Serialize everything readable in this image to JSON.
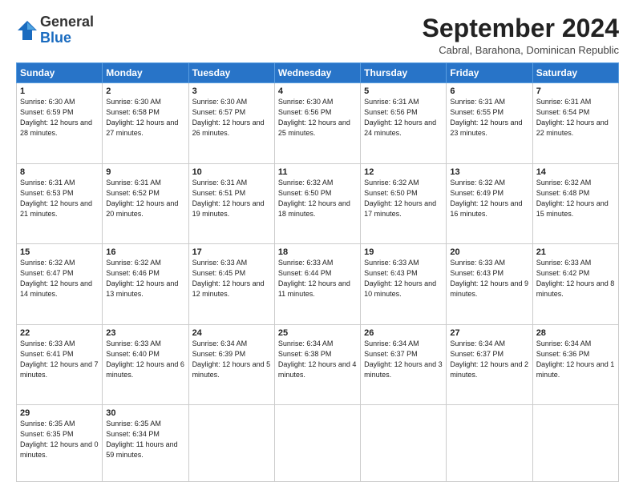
{
  "header": {
    "logo_general": "General",
    "logo_blue": "Blue",
    "month_title": "September 2024",
    "location": "Cabral, Barahona, Dominican Republic"
  },
  "days_of_week": [
    "Sunday",
    "Monday",
    "Tuesday",
    "Wednesday",
    "Thursday",
    "Friday",
    "Saturday"
  ],
  "weeks": [
    [
      {
        "day": "1",
        "sunrise": "6:30 AM",
        "sunset": "6:59 PM",
        "daylight": "12 hours and 28 minutes."
      },
      {
        "day": "2",
        "sunrise": "6:30 AM",
        "sunset": "6:58 PM",
        "daylight": "12 hours and 27 minutes."
      },
      {
        "day": "3",
        "sunrise": "6:30 AM",
        "sunset": "6:57 PM",
        "daylight": "12 hours and 26 minutes."
      },
      {
        "day": "4",
        "sunrise": "6:30 AM",
        "sunset": "6:56 PM",
        "daylight": "12 hours and 25 minutes."
      },
      {
        "day": "5",
        "sunrise": "6:31 AM",
        "sunset": "6:56 PM",
        "daylight": "12 hours and 24 minutes."
      },
      {
        "day": "6",
        "sunrise": "6:31 AM",
        "sunset": "6:55 PM",
        "daylight": "12 hours and 23 minutes."
      },
      {
        "day": "7",
        "sunrise": "6:31 AM",
        "sunset": "6:54 PM",
        "daylight": "12 hours and 22 minutes."
      }
    ],
    [
      {
        "day": "8",
        "sunrise": "6:31 AM",
        "sunset": "6:53 PM",
        "daylight": "12 hours and 21 minutes."
      },
      {
        "day": "9",
        "sunrise": "6:31 AM",
        "sunset": "6:52 PM",
        "daylight": "12 hours and 20 minutes."
      },
      {
        "day": "10",
        "sunrise": "6:31 AM",
        "sunset": "6:51 PM",
        "daylight": "12 hours and 19 minutes."
      },
      {
        "day": "11",
        "sunrise": "6:32 AM",
        "sunset": "6:50 PM",
        "daylight": "12 hours and 18 minutes."
      },
      {
        "day": "12",
        "sunrise": "6:32 AM",
        "sunset": "6:50 PM",
        "daylight": "12 hours and 17 minutes."
      },
      {
        "day": "13",
        "sunrise": "6:32 AM",
        "sunset": "6:49 PM",
        "daylight": "12 hours and 16 minutes."
      },
      {
        "day": "14",
        "sunrise": "6:32 AM",
        "sunset": "6:48 PM",
        "daylight": "12 hours and 15 minutes."
      }
    ],
    [
      {
        "day": "15",
        "sunrise": "6:32 AM",
        "sunset": "6:47 PM",
        "daylight": "12 hours and 14 minutes."
      },
      {
        "day": "16",
        "sunrise": "6:32 AM",
        "sunset": "6:46 PM",
        "daylight": "12 hours and 13 minutes."
      },
      {
        "day": "17",
        "sunrise": "6:33 AM",
        "sunset": "6:45 PM",
        "daylight": "12 hours and 12 minutes."
      },
      {
        "day": "18",
        "sunrise": "6:33 AM",
        "sunset": "6:44 PM",
        "daylight": "12 hours and 11 minutes."
      },
      {
        "day": "19",
        "sunrise": "6:33 AM",
        "sunset": "6:43 PM",
        "daylight": "12 hours and 10 minutes."
      },
      {
        "day": "20",
        "sunrise": "6:33 AM",
        "sunset": "6:43 PM",
        "daylight": "12 hours and 9 minutes."
      },
      {
        "day": "21",
        "sunrise": "6:33 AM",
        "sunset": "6:42 PM",
        "daylight": "12 hours and 8 minutes."
      }
    ],
    [
      {
        "day": "22",
        "sunrise": "6:33 AM",
        "sunset": "6:41 PM",
        "daylight": "12 hours and 7 minutes."
      },
      {
        "day": "23",
        "sunrise": "6:33 AM",
        "sunset": "6:40 PM",
        "daylight": "12 hours and 6 minutes."
      },
      {
        "day": "24",
        "sunrise": "6:34 AM",
        "sunset": "6:39 PM",
        "daylight": "12 hours and 5 minutes."
      },
      {
        "day": "25",
        "sunrise": "6:34 AM",
        "sunset": "6:38 PM",
        "daylight": "12 hours and 4 minutes."
      },
      {
        "day": "26",
        "sunrise": "6:34 AM",
        "sunset": "6:37 PM",
        "daylight": "12 hours and 3 minutes."
      },
      {
        "day": "27",
        "sunrise": "6:34 AM",
        "sunset": "6:37 PM",
        "daylight": "12 hours and 2 minutes."
      },
      {
        "day": "28",
        "sunrise": "6:34 AM",
        "sunset": "6:36 PM",
        "daylight": "12 hours and 1 minute."
      }
    ],
    [
      {
        "day": "29",
        "sunrise": "6:35 AM",
        "sunset": "6:35 PM",
        "daylight": "12 hours and 0 minutes."
      },
      {
        "day": "30",
        "sunrise": "6:35 AM",
        "sunset": "6:34 PM",
        "daylight": "11 hours and 59 minutes."
      },
      null,
      null,
      null,
      null,
      null
    ]
  ]
}
